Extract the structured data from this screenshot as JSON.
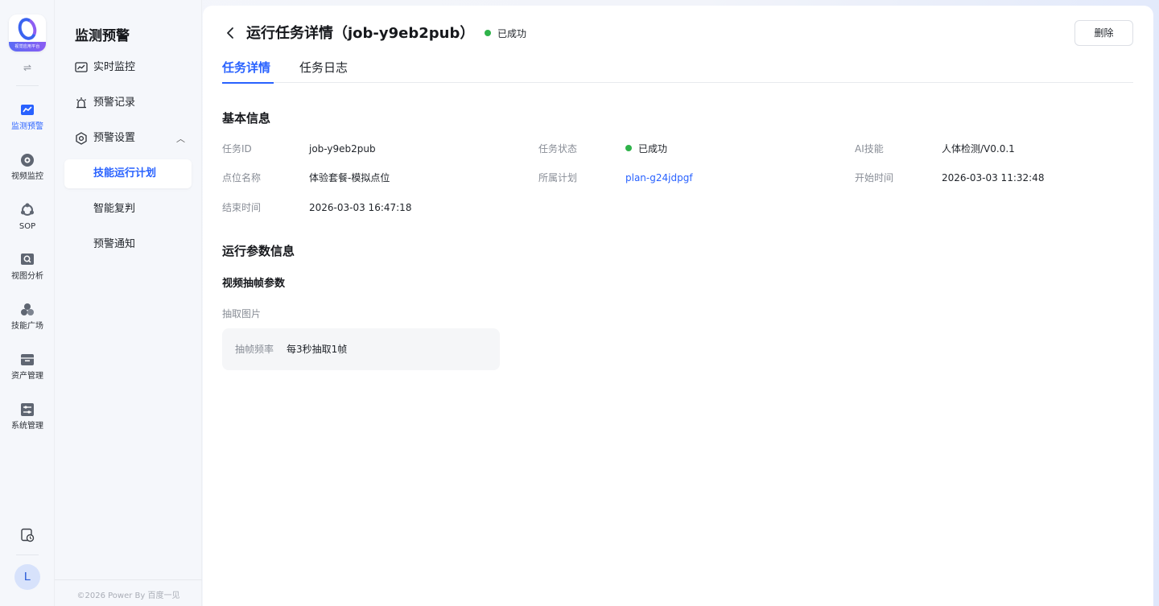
{
  "logo": {
    "text": "视觉应用平台"
  },
  "rail": {
    "items": [
      {
        "label": "监测预警",
        "icon": "chart-monitor-icon",
        "active": true
      },
      {
        "label": "视频监控",
        "icon": "camera-icon"
      },
      {
        "label": "SOP",
        "icon": "flow-icon"
      },
      {
        "label": "视图分析",
        "icon": "image-search-icon"
      },
      {
        "label": "技能广场",
        "icon": "cluster-icon"
      },
      {
        "label": "资产管理",
        "icon": "archive-icon"
      },
      {
        "label": "系统管理",
        "icon": "settings-sliders-icon"
      }
    ],
    "avatar": "L"
  },
  "subnav": {
    "title": "监测预警",
    "items": [
      {
        "label": "实时监控"
      },
      {
        "label": "预警记录"
      },
      {
        "label": "预警设置"
      },
      {
        "label": "技能运行计划"
      },
      {
        "label": "智能复判"
      },
      {
        "label": "预警通知"
      }
    ],
    "footer": "©2026 Power By 百度一见"
  },
  "header": {
    "title": "运行任务详情（job-y9eb2pub）",
    "status": "已成功",
    "delete_label": "删除"
  },
  "tabs": [
    {
      "label": "任务详情",
      "active": true
    },
    {
      "label": "任务日志"
    }
  ],
  "basic": {
    "title": "基本信息",
    "fields": {
      "task_id": {
        "label": "任务ID",
        "value": "job-y9eb2pub"
      },
      "task_status": {
        "label": "任务状态",
        "value": "已成功"
      },
      "ai_skill": {
        "label": "AI技能",
        "value": "人体检测/V0.0.1"
      },
      "point_name": {
        "label": "点位名称",
        "value": "体验套餐-模拟点位"
      },
      "plan": {
        "label": "所属计划",
        "value": "plan-g24jdpgf"
      },
      "start_time": {
        "label": "开始时间",
        "value": "2026-03-03 11:32:48"
      },
      "end_time": {
        "label": "结束时间",
        "value": "2026-03-03 16:47:18"
      }
    }
  },
  "params": {
    "title": "运行参数信息",
    "subtitle": "视频抽帧参数",
    "group_label": "抽取图片",
    "freq_label": "抽帧频率",
    "freq_value": "每3秒抽取1帧"
  },
  "colors": {
    "accent": "#2962ff",
    "success": "#2fb34a"
  }
}
